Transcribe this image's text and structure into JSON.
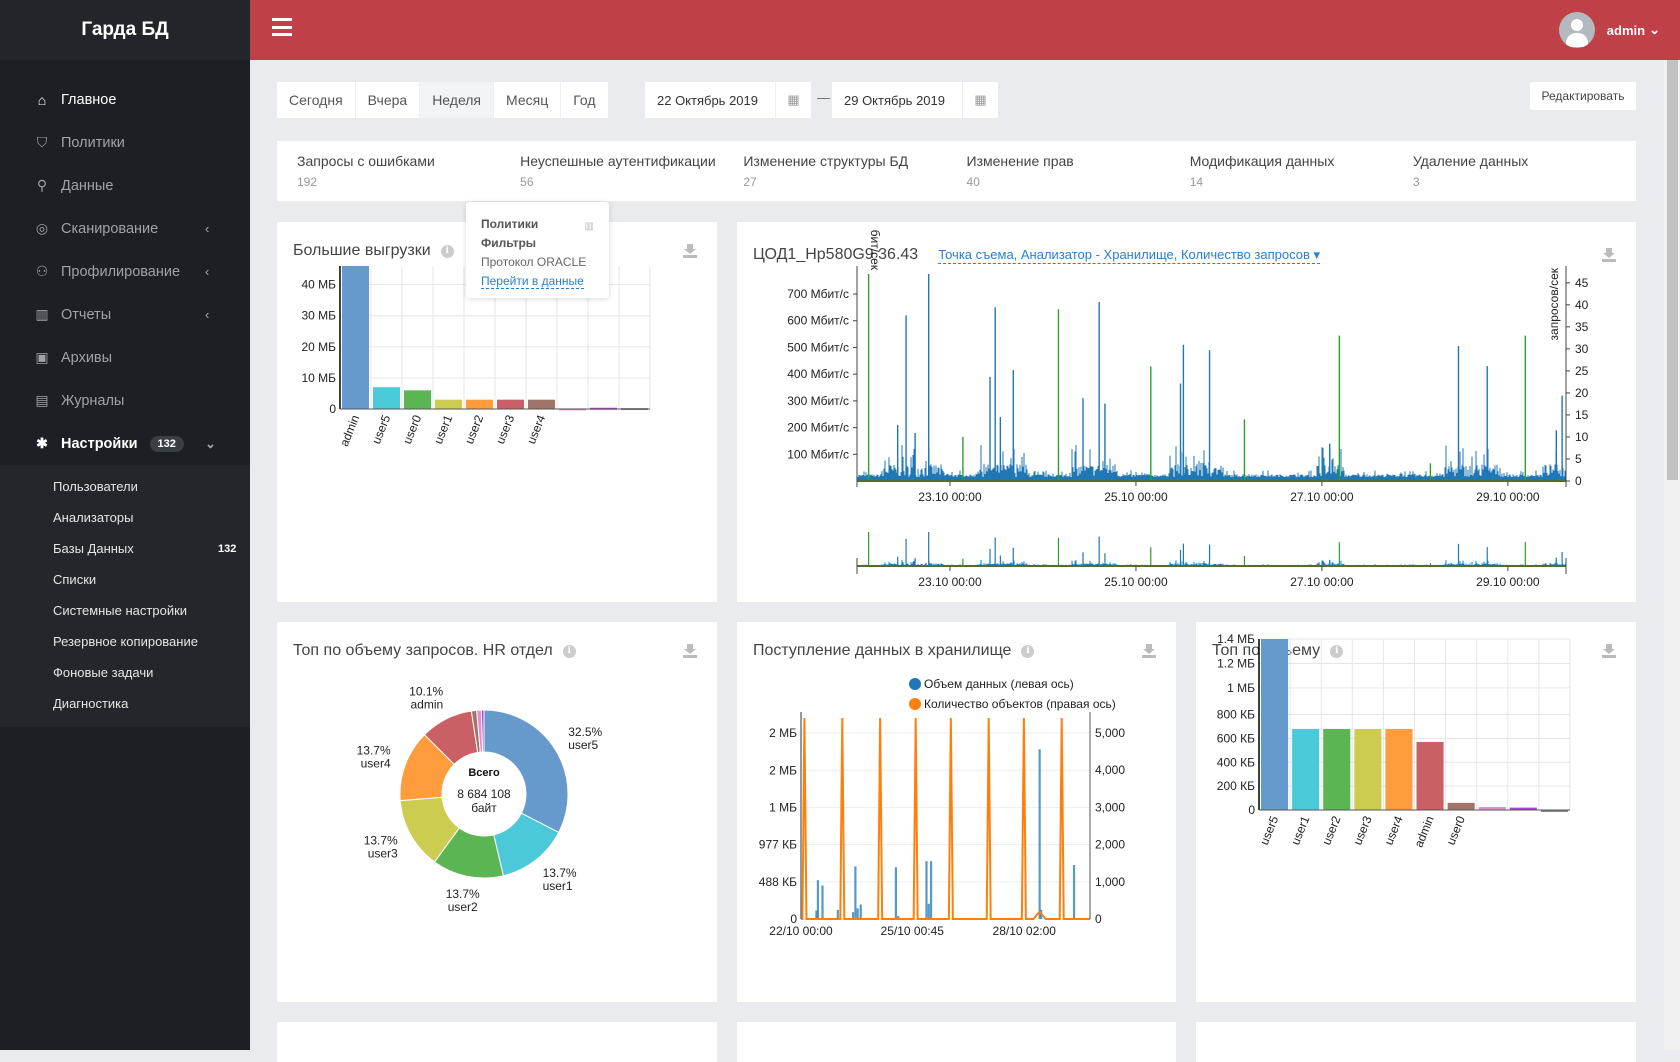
{
  "app": {
    "title": "Гарда БД"
  },
  "sidebar": {
    "items": [
      {
        "label": "Главное",
        "icon": "home-icon",
        "glyph": "⌂",
        "active": true
      },
      {
        "label": "Политики",
        "icon": "shield-icon",
        "glyph": "⛉"
      },
      {
        "label": "Данные",
        "icon": "search-icon",
        "glyph": "⚲"
      },
      {
        "label": "Сканирование",
        "icon": "target-icon",
        "glyph": "◎",
        "chevron": "‹"
      },
      {
        "label": "Профилирование",
        "icon": "users-icon",
        "glyph": "⚇",
        "chevron": "‹"
      },
      {
        "label": "Отчеты",
        "icon": "bar-chart-icon",
        "glyph": "▥",
        "chevron": "‹"
      },
      {
        "label": "Архивы",
        "icon": "floppy-icon",
        "glyph": "▣"
      },
      {
        "label": "Журналы",
        "icon": "file-icon",
        "glyph": "▤"
      },
      {
        "label": "Настройки",
        "icon": "gear-icon",
        "glyph": "✱",
        "badge": "132",
        "chevron": "⌄",
        "active": true
      }
    ],
    "submenu": [
      {
        "label": "Пользователи"
      },
      {
        "label": "Анализаторы"
      },
      {
        "label": "Базы Данных",
        "count": "132"
      },
      {
        "label": "Списки"
      },
      {
        "label": "Системные настройки"
      },
      {
        "label": "Резервное копирование"
      },
      {
        "label": "Фоновые задачи"
      },
      {
        "label": "Диагностика"
      }
    ]
  },
  "header": {
    "user": "admin",
    "chevron": "⌄",
    "accent": "#bf4047"
  },
  "filters": {
    "periods": [
      "Сегодня",
      "Вчера",
      "Неделя",
      "Месяц",
      "Год"
    ],
    "selected": "Неделя",
    "date_from": "22 Октябрь 2019",
    "date_to": "29 Октябрь 2019",
    "separator": "—",
    "calendar_glyph": "▦",
    "edit_label": "Редактировать"
  },
  "stats": [
    {
      "label": "Запросы с ошибками",
      "value": "192"
    },
    {
      "label": "Неуспешные аутентификации",
      "value": "56"
    },
    {
      "label": "Изменение структуры БД",
      "value": "27"
    },
    {
      "label": "Изменение прав",
      "value": "40"
    },
    {
      "label": "Модификация данных",
      "value": "14"
    },
    {
      "label": "Удаление данных",
      "value": "3"
    }
  ],
  "popover": {
    "line1": "Политики",
    "line2": "Фильтры",
    "line3": "Протокол ORACLE",
    "link": "Перейти в данные",
    "icon_glyph": "▥"
  },
  "widgets": {
    "big_exports": {
      "title": "Большие выгрузки"
    },
    "traffic": {
      "title": "ЦОД1_Hp580G9 36.43",
      "selector": "Точка съема, Анализатор - Хранилище, Количество запросов ▾"
    },
    "hr_top": {
      "title": "Топ по объему запросов. HR отдел"
    },
    "ingest": {
      "title": "Поступление данных в хранилище"
    },
    "top_volume": {
      "title": "Топ по объему"
    }
  },
  "chart_data": [
    {
      "id": "big_exports",
      "type": "bar",
      "categories": [
        "admin",
        "user5",
        "user0",
        "user1",
        "user2",
        "user3",
        "user4",
        "",
        "",
        ""
      ],
      "values": [
        46,
        7,
        6,
        3,
        3,
        3,
        3,
        0.2,
        0.4,
        0.3
      ],
      "unit": "МБ",
      "ylim": [
        0,
        46
      ],
      "yticks": [
        "0",
        "10 МБ",
        "20 МБ",
        "30 МБ",
        "40 МБ"
      ],
      "ytick_values": [
        0,
        10,
        20,
        30,
        40
      ],
      "colors": [
        "#6699cc",
        "#4bc9d9",
        "#5ab552",
        "#cccc50",
        "#ff9d3e",
        "#c96065",
        "#a07468",
        "#e38ed0",
        "#a944cc",
        "#888888"
      ],
      "grid": true
    },
    {
      "id": "traffic",
      "type": "line",
      "xlim": [
        "2019-10-22 00:00",
        "2019-10-29 15:00"
      ],
      "xticks": [
        "23.10 00:00",
        "25.10 00:00",
        "27.10 00:00",
        "29.10 00:00"
      ],
      "xtick_values": [
        "2019-10-23 00:00",
        "2019-10-25 00:00",
        "2019-10-27 00:00",
        "2019-10-29 00:00"
      ],
      "ylabel_left": "бит/сек",
      "ylabel_right": "запросов/сек",
      "yticks_left": [
        "100 Мбит/с",
        "200 Мбит/с",
        "300 Мбит/с",
        "400 Мбит/с",
        "500 Мбит/с",
        "600 Мбит/с",
        "700 Мбит/с"
      ],
      "ytick_values_left": [
        100,
        200,
        300,
        400,
        500,
        600,
        700
      ],
      "ylim_left": [
        0,
        775
      ],
      "yticks_right": [
        "0",
        "5",
        "10",
        "15",
        "20",
        "25",
        "30",
        "35",
        "40",
        "45"
      ],
      "ytick_values_right": [
        0,
        5,
        10,
        15,
        20,
        25,
        30,
        35,
        40,
        45
      ],
      "ylim_right": [
        0,
        47
      ],
      "series": [
        {
          "axis": "left",
          "color": "#1f77b4",
          "baseline": 15,
          "points": [
            [
              "2019-10-22 10:30",
              210
            ],
            [
              "2019-10-22 12:40",
              620
            ],
            [
              "2019-10-22 15:00",
              180
            ],
            [
              "2019-10-22 18:30",
              775
            ],
            [
              "2019-10-23 10:20",
              390
            ],
            [
              "2019-10-23 11:40",
              650
            ],
            [
              "2019-10-23 13:00",
              240
            ],
            [
              "2019-10-23 16:20",
              415
            ],
            [
              "2019-10-24 10:20",
              310
            ],
            [
              "2019-10-24 14:30",
              670
            ],
            [
              "2019-10-24 16:00",
              290
            ],
            [
              "2019-10-25 11:30",
              365
            ],
            [
              "2019-10-25 12:15",
              510
            ],
            [
              "2019-10-25 19:00",
              490
            ],
            [
              "2019-10-27 02:00",
              140
            ],
            [
              "2019-10-28 11:15",
              505
            ],
            [
              "2019-10-28 18:40",
              430
            ],
            [
              "2019-10-29 12:30",
              190
            ],
            [
              "2019-10-29 14:00",
              320
            ]
          ]
        },
        {
          "axis": "right",
          "color": "#2ca02c",
          "points": [
            [
              "2019-10-22 03:00",
              47
            ],
            [
              "2019-10-23 03:20",
              10
            ],
            [
              "2019-10-24 04:00",
              39
            ],
            [
              "2019-10-25 03:50",
              26
            ],
            [
              "2019-10-26 04:00",
              14
            ],
            [
              "2019-10-27 04:30",
              33
            ],
            [
              "2019-10-28 04:00",
              4
            ],
            [
              "2019-10-29 04:30",
              33
            ]
          ]
        }
      ]
    },
    {
      "id": "hr_top",
      "type": "pie",
      "donut": true,
      "center_label": "Всего",
      "center_value": "8 684 108",
      "center_unit": "байт",
      "slices": [
        {
          "name": "user5",
          "value": 32.5,
          "label": "32.5%",
          "color": "#6699cc"
        },
        {
          "name": "user1",
          "value": 13.7,
          "label": "13.7%",
          "color": "#4bc9d9"
        },
        {
          "name": "user2",
          "value": 13.7,
          "label": "13.7%",
          "color": "#5ab552"
        },
        {
          "name": "user3",
          "value": 13.7,
          "label": "13.7%",
          "color": "#cccc50"
        },
        {
          "name": "user4",
          "value": 13.7,
          "label": "13.7%",
          "color": "#ff9d3e"
        },
        {
          "name": "admin",
          "value": 10.1,
          "label": "10.1%",
          "color": "#c96065"
        },
        {
          "name": "",
          "value": 1.0,
          "label": "",
          "color": "#a07468"
        },
        {
          "name": "",
          "value": 0.9,
          "label": "",
          "color": "#e38ed0"
        },
        {
          "name": "",
          "value": 0.5,
          "label": "",
          "color": "#a944cc"
        }
      ]
    },
    {
      "id": "ingest",
      "type": "line",
      "xlim": [
        "2019-10-22 00:00",
        "2019-10-29 21:00"
      ],
      "xticks": [
        "22/10 00:00",
        "25/10 00:45",
        "28/10 02:00"
      ],
      "xtick_values": [
        "2019-10-22 00:00",
        "2019-10-25 00:45",
        "2019-10-28 02:00"
      ],
      "yticks_left": [
        "0",
        "488 КБ",
        "977 КБ",
        "1 МБ",
        "2 МБ",
        "2 МБ"
      ],
      "ytick_values_left": [
        0,
        488,
        977,
        1465,
        1953,
        2441
      ],
      "ylim_left": [
        0,
        2640
      ],
      "yticks_right": [
        "0",
        "1,000",
        "2,000",
        "3,000",
        "4,000",
        "5,000"
      ],
      "ytick_values_right": [
        0,
        1000,
        2000,
        3000,
        4000,
        5000
      ],
      "ylim_right": [
        0,
        5400
      ],
      "series": [
        {
          "name": "Объем данных (левая ось)",
          "axis": "left",
          "type": "bar",
          "color": "#1f77b4",
          "points": [
            [
              "2019-10-22 10:00",
              110
            ],
            [
              "2019-10-22 11:00",
              510
            ],
            [
              "2019-10-22 14:00",
              440
            ],
            [
              "2019-10-23 00:00",
              120
            ],
            [
              "2019-10-23 10:00",
              90
            ],
            [
              "2019-10-23 11:30",
              690
            ],
            [
              "2019-10-23 13:00",
              140
            ],
            [
              "2019-10-23 15:00",
              190
            ],
            [
              "2019-10-24 14:00",
              680
            ],
            [
              "2019-10-24 15:30",
              40
            ],
            [
              "2019-10-25 10:00",
              760
            ],
            [
              "2019-10-25 11:30",
              200
            ],
            [
              "2019-10-25 13:00",
              760
            ],
            [
              "2019-10-28 12:00",
              2230
            ],
            [
              "2019-10-28 13:00",
              120
            ],
            [
              "2019-10-29 10:30",
              710
            ]
          ]
        },
        {
          "name": "Количество объектов (правая ось)",
          "axis": "right",
          "type": "line",
          "color": "#ff7f0e",
          "points": [
            [
              "2019-10-22 02:15",
              5400
            ],
            [
              "2019-10-23 03:00",
              5400
            ],
            [
              "2019-10-24 03:45",
              5400
            ],
            [
              "2019-10-25 03:00",
              5400
            ],
            [
              "2019-10-26 02:00",
              5400
            ],
            [
              "2019-10-27 02:45",
              5400
            ],
            [
              "2019-10-28 01:45",
              5400
            ],
            [
              "2019-10-28 12:00",
              200
            ],
            [
              "2019-10-29 02:30",
              5400
            ]
          ]
        }
      ]
    },
    {
      "id": "top_volume",
      "type": "bar",
      "categories": [
        "user5",
        "user1",
        "user2",
        "user3",
        "user4",
        "admin",
        "user0",
        "",
        "",
        ""
      ],
      "values": [
        1434,
        680,
        680,
        680,
        680,
        570,
        60,
        25,
        20,
        0
      ],
      "unit": "КБ",
      "ylim": [
        0,
        1434
      ],
      "yticks": [
        "0",
        "200 КБ",
        "400 КБ",
        "600 КБ",
        "800 КБ",
        "1 МБ",
        "1.2 МБ",
        "1.4 МБ"
      ],
      "ytick_values": [
        0,
        200,
        400,
        600,
        800,
        1024,
        1229,
        1434
      ],
      "colors": [
        "#6699cc",
        "#4bc9d9",
        "#5ab552",
        "#cccc50",
        "#ff9d3e",
        "#c96065",
        "#a07468",
        "#e38ed0",
        "#a944cc",
        "#888888"
      ],
      "grid": true
    }
  ]
}
